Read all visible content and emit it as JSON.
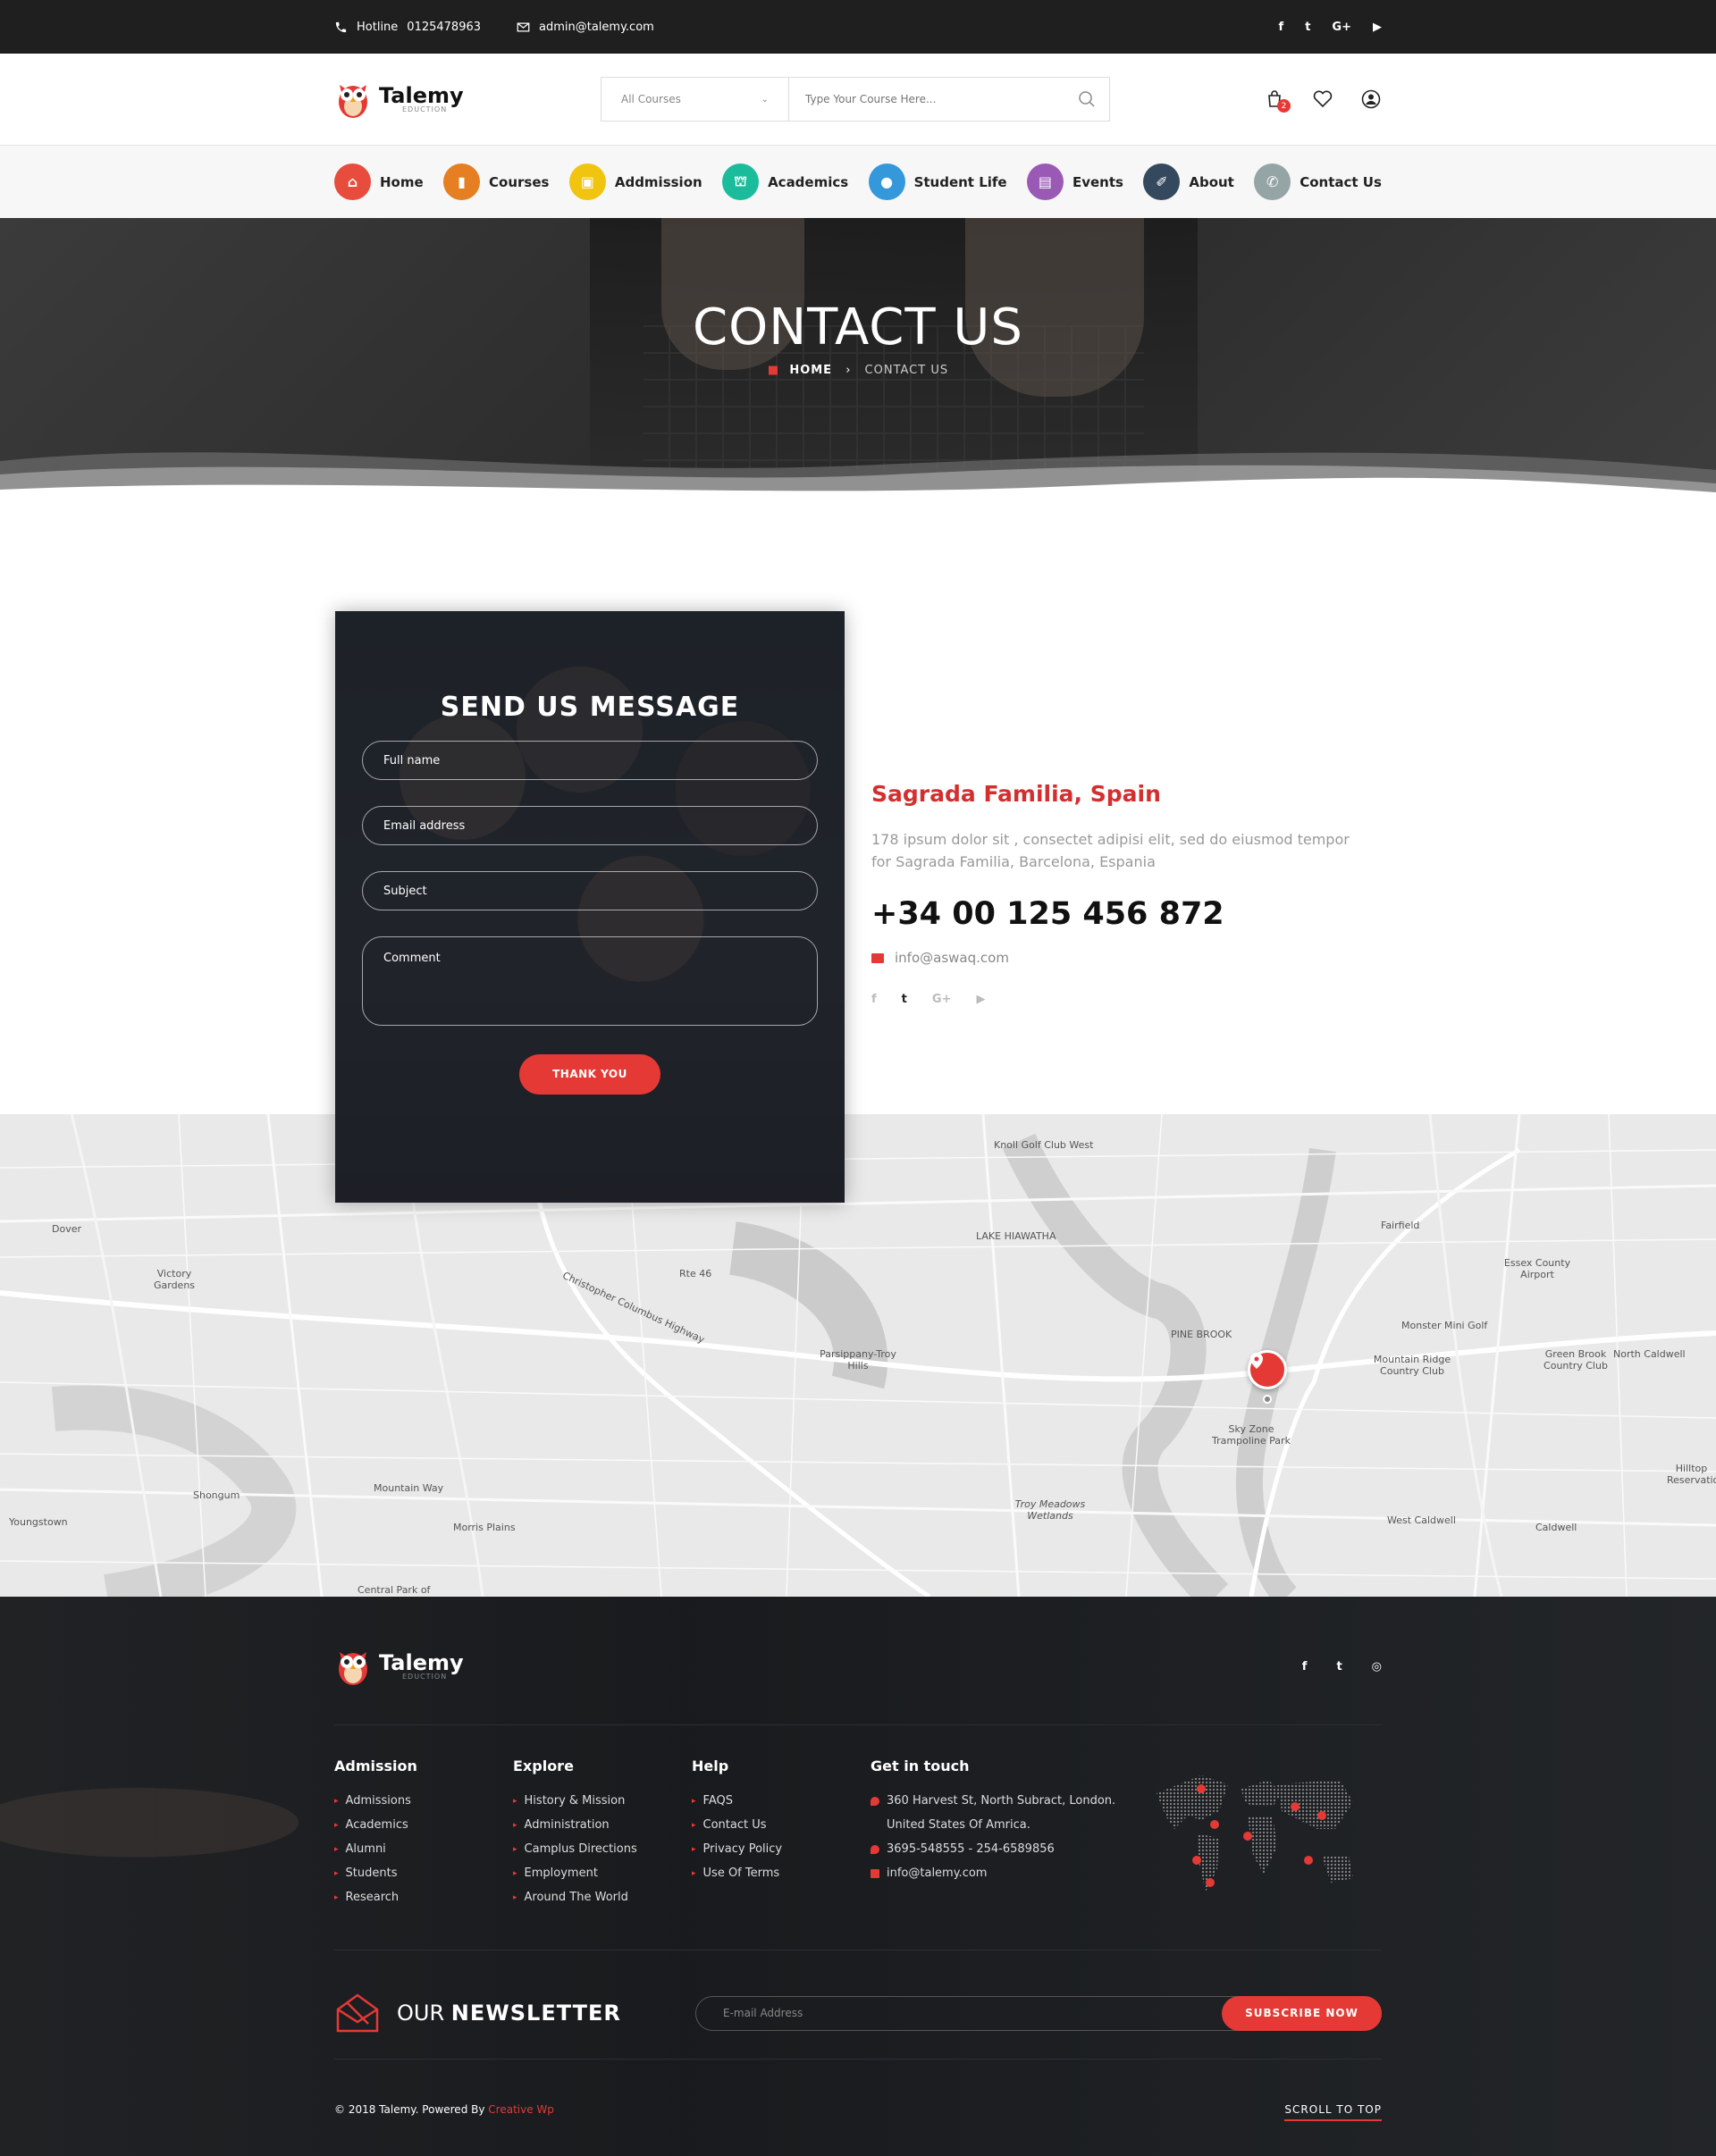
{
  "topbar": {
    "hotline_label": "Hotline",
    "hotline_number": "0125478963",
    "email": "admin@talemy.com",
    "social": [
      "f",
      "t",
      "G+",
      "▶"
    ]
  },
  "header": {
    "logo_name": "Talemy",
    "logo_sub": "EDUCTION",
    "search_category": "All Courses",
    "search_placeholder": "Type Your Course Here...",
    "cart_count": "2"
  },
  "nav": {
    "items": [
      {
        "label": "Home",
        "color": "#e74c3c",
        "icon": "home-icon"
      },
      {
        "label": "Courses",
        "color": "#e67e22",
        "icon": "book-icon"
      },
      {
        "label": "Addmission",
        "color": "#f1c40f",
        "icon": "admission-icon"
      },
      {
        "label": "Academics",
        "color": "#1abc9c",
        "icon": "academics-icon"
      },
      {
        "label": "Student Life",
        "color": "#3498db",
        "icon": "student-icon"
      },
      {
        "label": "Events",
        "color": "#9b59b6",
        "icon": "events-icon"
      },
      {
        "label": "About",
        "color": "#34495e",
        "icon": "about-icon"
      },
      {
        "label": "Contact Us",
        "color": "#95a5a6",
        "icon": "phone-icon"
      }
    ]
  },
  "hero": {
    "title": "CONTACT US",
    "crumb_home": "HOME",
    "crumb_current": "CONTACT US"
  },
  "form": {
    "title": "SEND US MESSAGE",
    "full_name": "Full name",
    "email": "Email address",
    "subject": "Subject",
    "comment": "Comment",
    "submit": "THANK YOU"
  },
  "info": {
    "title": "Sagrada Familia, Spain",
    "text": "178 ipsum dolor sit , consectet adipisi elit, sed do eiusmod tempor for Sagrada Familia, Barcelona, Espania",
    "phone": "+34 00 125 456 872",
    "email": "info@aswaq.com",
    "social": [
      "f",
      "t",
      "G+",
      "▶"
    ]
  },
  "map": {
    "labels": {
      "knoll": "Knoll Golf Club West",
      "hiawatha": "LAKE HIAWATHA",
      "pinebrook": "PINE BROOK",
      "parsippany": "Parsippany-Troy Hills",
      "fairfield": "Fairfield",
      "essex": "Essex County Airport",
      "mountain_ridge": "Mountain Ridge Country Club",
      "green_brook": "Green Brook Country Club",
      "north_caldwell": "North Caldwell",
      "monster": "Monster Mini Golf",
      "sky_zone": "Sky Zone Trampoline Park",
      "troy_meadows": "Troy Meadows Wetlands",
      "west_caldwell": "West Caldwell",
      "caldwell": "Caldwell",
      "victory": "Victory Gardens",
      "dover": "Dover",
      "shongum": "Shongum",
      "morris_plains": "Morris Plains",
      "youngstown": "Youngstown",
      "mountain_way": "Mountain Way",
      "central_park": "Central Park of",
      "hilltop": "Hilltop Reservatio",
      "rte46": "Rte 46",
      "columbus": "Christopher Columbus Highway"
    }
  },
  "footer": {
    "logo_name": "Talemy",
    "logo_sub": "EDUCTION",
    "social": [
      "f",
      "t",
      "◎"
    ],
    "columns": [
      {
        "title": "Admission",
        "items": [
          "Admissions",
          "Academics",
          "Alumni",
          "Students",
          "Research"
        ]
      },
      {
        "title": "Explore",
        "items": [
          "History & Mission",
          "Administration",
          "Camplus Directions",
          "Employment",
          "Around The World"
        ]
      },
      {
        "title": "Help",
        "items": [
          "FAQS",
          "Contact Us",
          "Privacy Policy",
          "Use Of Terms"
        ]
      }
    ],
    "contact": {
      "title": "Get in touch",
      "address1": "360 Harvest St, North Subract, London.",
      "address2": "United States Of Amrica.",
      "phones": "3695-548555   -   254-6589856",
      "email": "info@talemy.com"
    },
    "newsletter_prefix": "OUR",
    "newsletter_strong": "NEWSLETTER",
    "newsletter_placeholder": "E-mail Address",
    "newsletter_button": "SUBSCRIBE NOW",
    "copyright": "© 2018 Talemy.  Powered By",
    "powered": "Creative Wp",
    "scroll_top": "SCROLL TO TOP"
  },
  "colors": {
    "accent": "#e53935",
    "dark": "#1f1f1f"
  }
}
